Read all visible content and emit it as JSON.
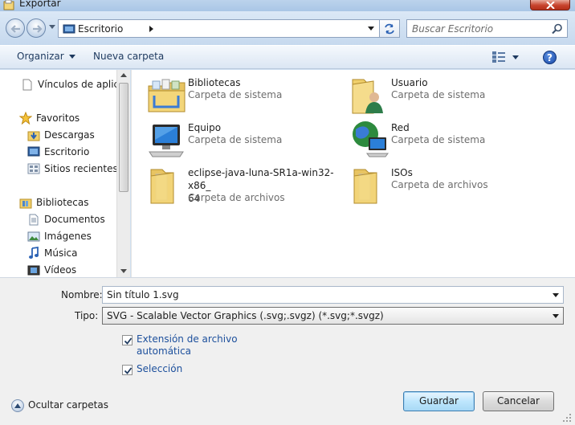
{
  "window": {
    "title": "Exportar"
  },
  "address": {
    "location": "Escritorio"
  },
  "search": {
    "placeholder": "Buscar Escritorio"
  },
  "toolbar": {
    "organize_label": "Organizar",
    "new_folder_label": "Nueva carpeta"
  },
  "sidebar": {
    "items": [
      {
        "label": "Vínculos de aplicac",
        "icon": "document-icon",
        "level": 0
      },
      {
        "label": "Favoritos",
        "icon": "star-icon",
        "level": 0
      },
      {
        "label": "Descargas",
        "icon": "downloads-folder-icon",
        "level": 1
      },
      {
        "label": "Escritorio",
        "icon": "desktop-icon",
        "level": 1
      },
      {
        "label": "Sitios recientes",
        "icon": "recent-places-icon",
        "level": 1
      },
      {
        "label": "Bibliotecas",
        "icon": "libraries-icon",
        "level": 0
      },
      {
        "label": "Documentos",
        "icon": "documents-icon",
        "level": 1
      },
      {
        "label": "Imágenes",
        "icon": "pictures-icon",
        "level": 1
      },
      {
        "label": "Música",
        "icon": "music-icon",
        "level": 1
      },
      {
        "label": "Vídeos",
        "icon": "videos-icon",
        "level": 1
      }
    ]
  },
  "content": {
    "items": [
      {
        "name": "Bibliotecas",
        "type": "Carpeta de sistema",
        "icon": "libraries-folder-icon"
      },
      {
        "name": "Usuario",
        "type": "Carpeta de sistema",
        "icon": "user-folder-icon"
      },
      {
        "name": "Equipo",
        "type": "Carpeta de sistema",
        "icon": "computer-icon"
      },
      {
        "name": "Red",
        "type": "Carpeta de sistema",
        "icon": "network-icon"
      },
      {
        "name": "eclipse-java-luna-SR1a-win32-x86_\n64",
        "type": "Carpeta de archivos",
        "icon": "folder-icon"
      },
      {
        "name": "ISOs",
        "type": "Carpeta de archivos",
        "icon": "folder-icon"
      }
    ]
  },
  "form": {
    "name_label": "Nombre:",
    "name_value": "Sin título 1.svg",
    "type_label": "Tipo:",
    "type_value": "SVG - Scalable Vector Graphics (.svg;.svgz) (*.svg;*.svgz)",
    "auto_extension_label": "Extensión de archivo\nautomática",
    "auto_extension_checked": true,
    "selection_label": "Selección",
    "selection_checked": true
  },
  "footer": {
    "hide_folders_label": "Ocultar carpetas",
    "save_label": "Guardar",
    "cancel_label": "Cancelar"
  },
  "colors": {
    "link_blue": "#1c4f9c",
    "window_frame": "#cfdff0",
    "close_red": "#c7432d"
  }
}
